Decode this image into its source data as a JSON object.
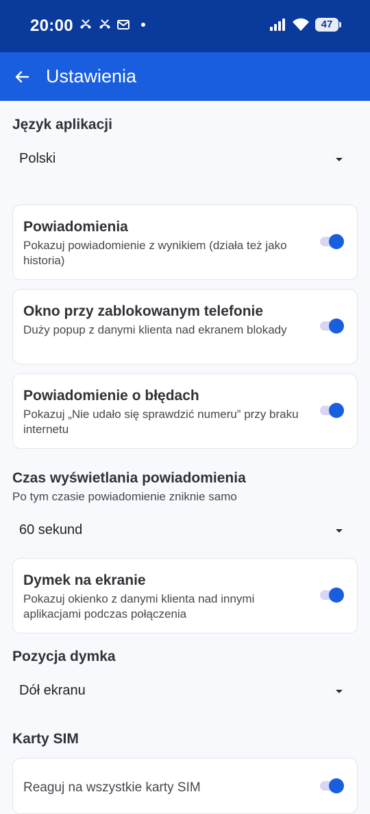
{
  "status_bar": {
    "time": "20:00",
    "left_icons": [
      "missed-call-icon",
      "missed-call-icon",
      "mail-icon",
      "dot-icon"
    ],
    "right_icons": [
      "signal-icon",
      "wifi-icon",
      "battery-icon"
    ],
    "battery": "47"
  },
  "app_bar": {
    "title": "Ustawienia",
    "back_icon": "arrow-left-icon",
    "color": "#1a5ee0"
  },
  "language": {
    "title": "Język aplikacji",
    "value": "Polski"
  },
  "cards": [
    {
      "title": "Powiadomienia",
      "desc": "Pokazuj powiadomienie z wynikiem (działa też jako historia)",
      "enabled": true
    },
    {
      "title": "Okno przy zablokowanym telefonie",
      "desc": "Duży popup z danymi klienta nad ekranem blokady",
      "enabled": true
    },
    {
      "title": "Powiadomienie o błędach",
      "desc": "Pokazuj „Nie udało się sprawdzić numeru” przy braku internetu",
      "enabled": true
    }
  ],
  "duration": {
    "title": "Czas wyświetlania powiadomienia",
    "subtitle": "Po tym czasie powiadomienie zniknie samo",
    "value": "60 sekund"
  },
  "bubble_card": {
    "title": "Dymek na ekranie",
    "desc": "Pokazuj okienko z danymi klienta nad innymi aplikacjami podczas połączenia",
    "enabled": true
  },
  "bubble_position": {
    "title": "Pozycja dymka",
    "value": "Dół ekranu"
  },
  "sim": {
    "title": "Karty SIM",
    "card_label": "Reaguj na wszystkie karty SIM",
    "enabled": true
  }
}
